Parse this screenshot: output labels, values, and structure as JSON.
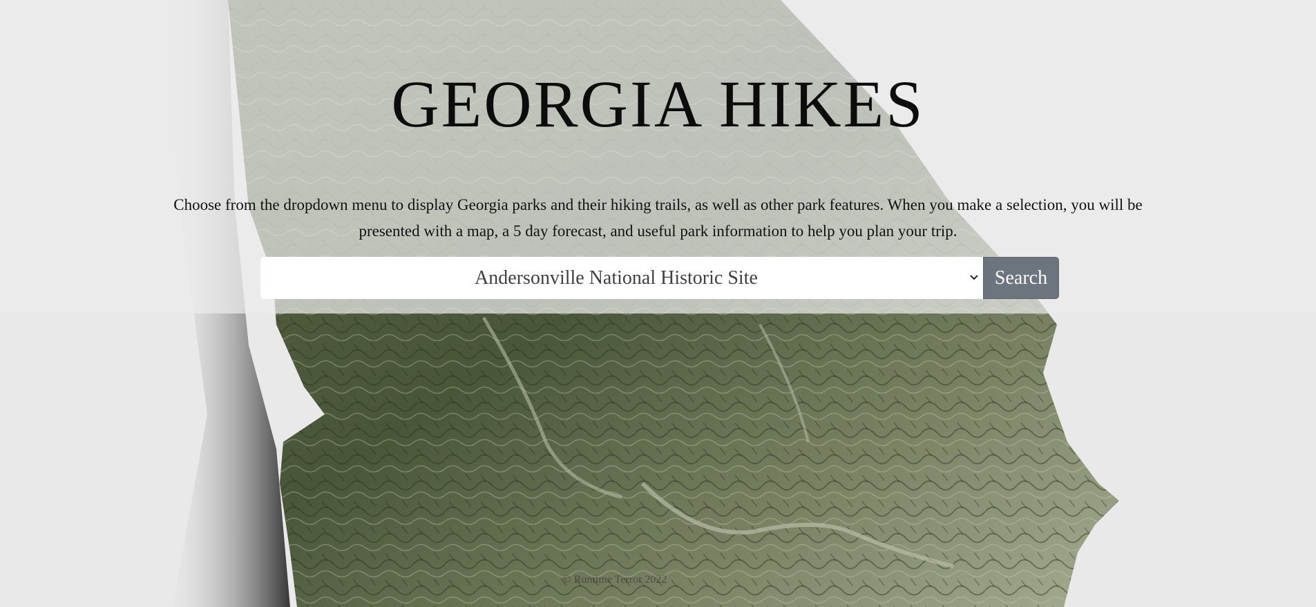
{
  "header": {
    "title": "GEORGIA HIKES",
    "intro": "Choose from the dropdown menu to display Georgia parks and their hiking trails, as well as other park features. When you make a selection, you will be presented with a map, a 5 day forecast, and useful park information to help you plan your trip."
  },
  "search": {
    "selected_park": "Andersonville National Historic Site",
    "button_label": "Search"
  },
  "footer": {
    "copyright": "© Runtime Terror 2022"
  },
  "colors": {
    "page_background": "#e9e9e9",
    "button_background": "#6c757d",
    "map_dark_green": "#3f4a33",
    "map_light_green": "#9aa487"
  },
  "icons": {
    "select_arrow": "chevron-down-icon"
  }
}
